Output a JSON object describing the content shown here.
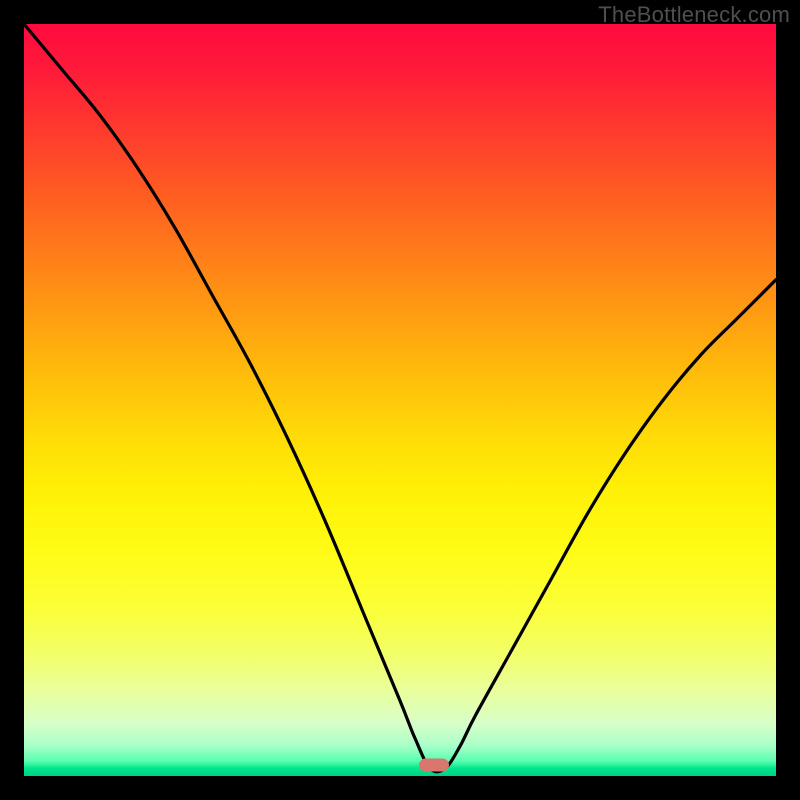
{
  "watermark": "TheBottleneck.com",
  "marker": {
    "x_pct": 54.5,
    "y_pct": 98.5
  },
  "chart_data": {
    "type": "line",
    "title": "",
    "xlabel": "",
    "ylabel": "",
    "xlim": [
      0,
      100
    ],
    "ylim": [
      0,
      100
    ],
    "grid": false,
    "legend": false,
    "background_gradient": {
      "orientation": "vertical",
      "stops": [
        {
          "pct": 0,
          "color": "#ff0a3f"
        },
        {
          "pct": 50,
          "color": "#ffd808"
        },
        {
          "pct": 78,
          "color": "#fbff3a"
        },
        {
          "pct": 100,
          "color": "#00d084"
        }
      ]
    },
    "series": [
      {
        "name": "bottleneck-curve",
        "x": [
          0,
          5,
          10,
          15,
          20,
          25,
          30,
          35,
          40,
          45,
          50,
          52,
          54,
          56,
          58,
          60,
          65,
          70,
          75,
          80,
          85,
          90,
          95,
          100
        ],
        "values": [
          100,
          94,
          88,
          81,
          73,
          64,
          55,
          45,
          34,
          22,
          10,
          5,
          1,
          1,
          4,
          8,
          17,
          26,
          35,
          43,
          50,
          56,
          61,
          66
        ]
      }
    ],
    "marker_point": {
      "x": 54.5,
      "y": 1.5,
      "color": "#d9766d"
    },
    "notes": "Axes have no visible ticks or labels; values are estimated percentages read off the plot area (0,0 bottom-left to 100,100 top-right)."
  }
}
